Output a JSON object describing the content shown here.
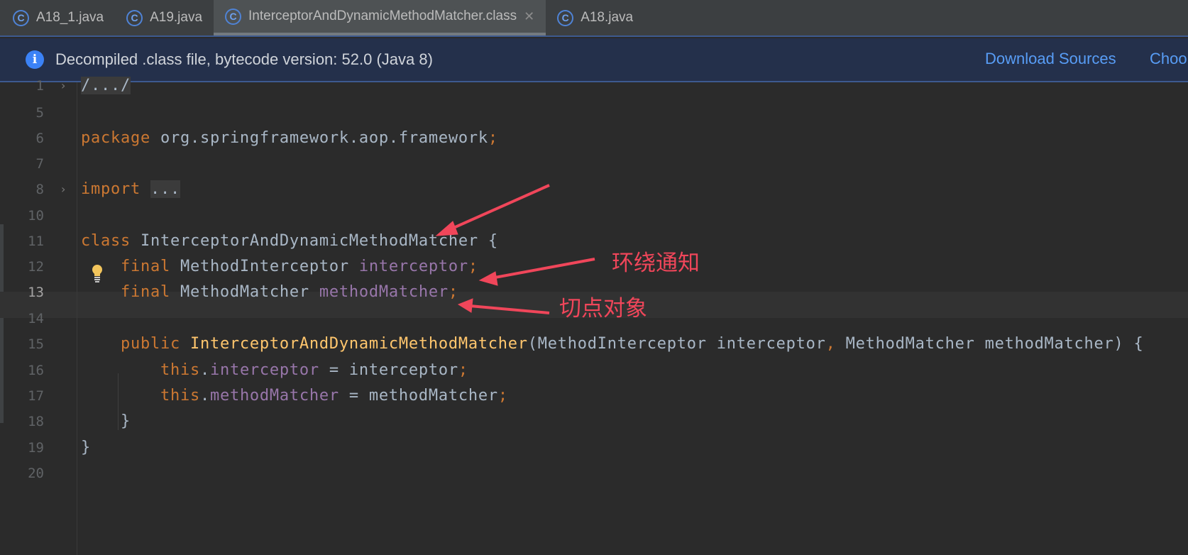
{
  "tabs": [
    {
      "label": "A18_1.java",
      "active": false
    },
    {
      "label": "A19.java",
      "active": false
    },
    {
      "label": "InterceptorAndDynamicMethodMatcher.class",
      "active": true
    },
    {
      "label": "A18.java",
      "active": false
    }
  ],
  "banner": {
    "icon": "info-icon",
    "message": "Decompiled .class file, bytecode version: 52.0 (Java 8)",
    "download_sources": "Download Sources",
    "choose_sources": "Choo"
  },
  "current_line": "13",
  "lines": [
    {
      "num": "1",
      "tokens": [
        {
          "t": "/.../",
          "c": "fold"
        }
      ],
      "fold": true
    },
    {
      "num": "5",
      "tokens": []
    },
    {
      "num": "6",
      "tokens": [
        {
          "t": "package ",
          "c": "k"
        },
        {
          "t": "org.springframework.aop.framework"
        },
        {
          "t": ";",
          "c": "k"
        }
      ]
    },
    {
      "num": "7",
      "tokens": []
    },
    {
      "num": "8",
      "tokens": [
        {
          "t": "import ",
          "c": "k"
        },
        {
          "t": "...",
          "c": "fold"
        }
      ],
      "fold": true
    },
    {
      "num": "10",
      "tokens": []
    },
    {
      "num": "11",
      "tokens": [
        {
          "t": "class ",
          "c": "k"
        },
        {
          "t": "InterceptorAndDynamicMethodMatcher {"
        }
      ]
    },
    {
      "num": "12",
      "tokens": [
        {
          "t": "    final ",
          "c": "k"
        },
        {
          "t": "MethodInterceptor "
        },
        {
          "t": "interceptor",
          "c": "f"
        },
        {
          "t": ";",
          "c": "k"
        }
      ]
    },
    {
      "num": "13",
      "tokens": [
        {
          "t": "    final ",
          "c": "k"
        },
        {
          "t": "MethodMatcher "
        },
        {
          "t": "methodMatcher",
          "c": "f"
        },
        {
          "t": ";",
          "c": "k"
        }
      ]
    },
    {
      "num": "14",
      "tokens": []
    },
    {
      "num": "15",
      "tokens": [
        {
          "t": "    public ",
          "c": "k"
        },
        {
          "t": "InterceptorAndDynamicMethodMatcher",
          "c": "m"
        },
        {
          "t": "(MethodInterceptor interceptor"
        },
        {
          "t": ", ",
          "c": "k"
        },
        {
          "t": "MethodMatcher methodMatcher) {"
        }
      ]
    },
    {
      "num": "16",
      "tokens": [
        {
          "t": "        this",
          "c": "k"
        },
        {
          "t": "."
        },
        {
          "t": "interceptor",
          "c": "f"
        },
        {
          "t": " = interceptor"
        },
        {
          "t": ";",
          "c": "k"
        }
      ]
    },
    {
      "num": "17",
      "tokens": [
        {
          "t": "        this",
          "c": "k"
        },
        {
          "t": "."
        },
        {
          "t": "methodMatcher",
          "c": "f"
        },
        {
          "t": " = methodMatcher"
        },
        {
          "t": ";",
          "c": "k"
        }
      ]
    },
    {
      "num": "18",
      "tokens": [
        {
          "t": "    }"
        }
      ]
    },
    {
      "num": "19",
      "tokens": [
        {
          "t": "}"
        }
      ]
    },
    {
      "num": "20",
      "tokens": []
    }
  ],
  "annotations": {
    "around_advice": "环绕通知",
    "pointcut_object": "切点对象",
    "color": "#f0465a"
  }
}
